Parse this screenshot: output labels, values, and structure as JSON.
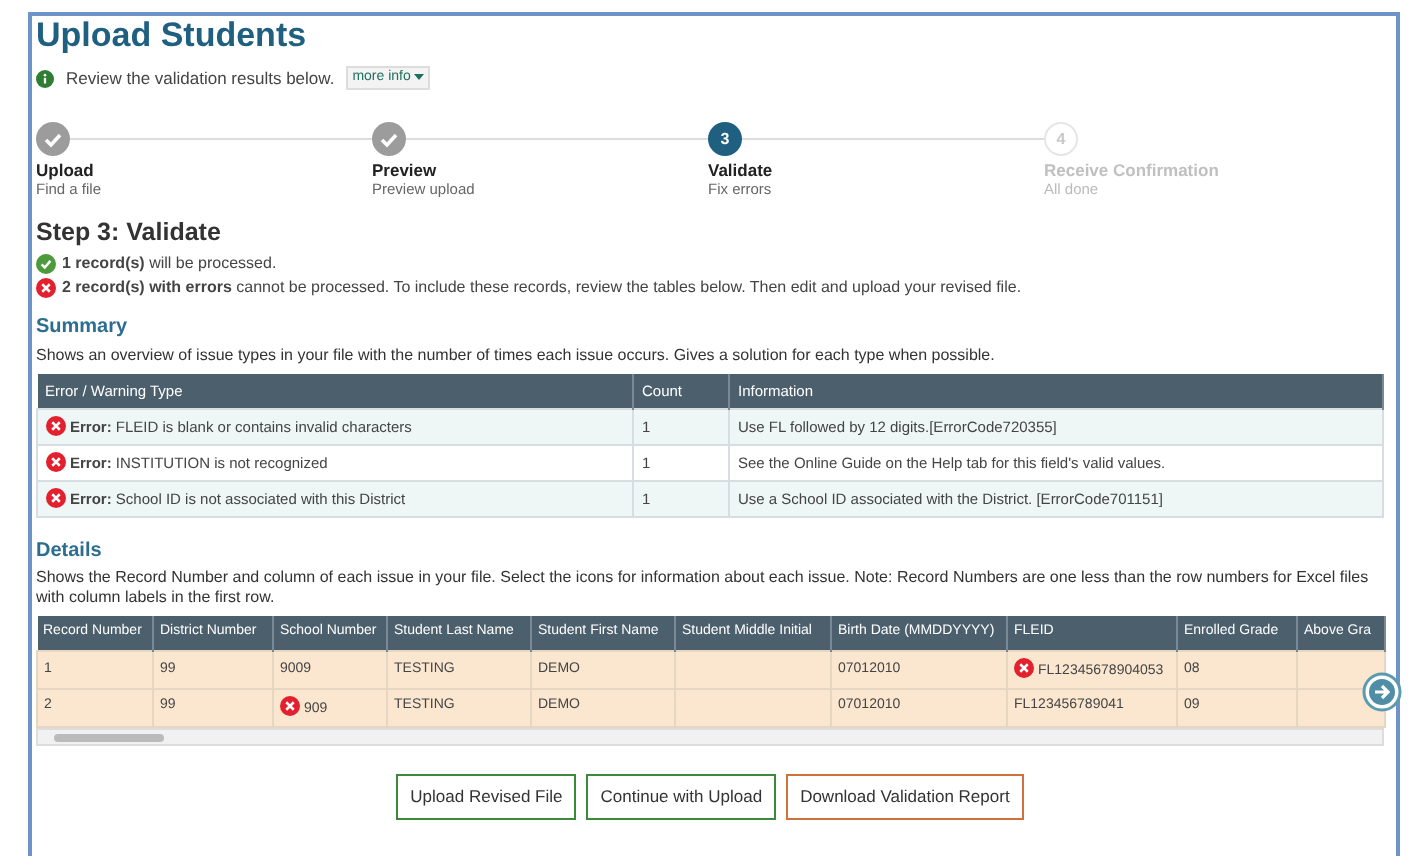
{
  "title": "Upload Students",
  "info": {
    "text": "Review the validation results below.",
    "more_info": "more info"
  },
  "steps": [
    {
      "label": "Upload",
      "sublabel": "Find a file",
      "kind": "done"
    },
    {
      "label": "Preview",
      "sublabel": "Preview upload",
      "kind": "done"
    },
    {
      "number": "3",
      "label": "Validate",
      "sublabel": "Fix errors",
      "kind": "current"
    },
    {
      "number": "4",
      "label": "Receive Confirmation",
      "sublabel": "All done",
      "kind": "pending"
    }
  ],
  "step_heading": "Step 3: Validate",
  "results": [
    {
      "kind": "ok",
      "text": "**1 record(s)** will be processed."
    },
    {
      "kind": "error",
      "text": "**2 record(s) with errors** cannot be processed. To include these records, review the tables below. Then edit and upload your revised file."
    }
  ],
  "summary": {
    "heading": "Summary",
    "description": "Shows an overview of issue types in your file with the number of times each issue occurs. Gives a solution for each type when possible.",
    "columns": [
      "Error / Warning Type",
      "Count",
      "Information"
    ],
    "rows": [
      {
        "kind": "error",
        "type": "**Error:** FLEID is blank or contains invalid characters",
        "count": "1",
        "information": "Use FL followed by 12 digits.[ErrorCode720355]"
      },
      {
        "kind": "error",
        "type": "**Error:** INSTITUTION is not recognized",
        "count": "1",
        "information": "See the Online Guide on the Help tab for this field's valid values."
      },
      {
        "kind": "error",
        "type": "**Error:** School ID is not associated with this District",
        "count": "1",
        "information": "Use a School ID associated with the District. [ErrorCode701151]"
      }
    ]
  },
  "details": {
    "heading": "Details",
    "description": "Shows the Record Number and column of each issue in your file. Select the icons for information about each issue. Note: Record Numbers are one less than the row numbers for Excel files with column labels in the first row.",
    "columns": [
      "Record Number",
      "District Number",
      "School Number",
      "Student Last Name",
      "Student First Name",
      "Student Middle Initial",
      "Birth Date (MMDDYYYY)",
      "FLEID",
      "Enrolled Grade",
      "Above Gra"
    ],
    "rows": [
      {
        "cells": [
          {
            "text": "1",
            "error": false
          },
          {
            "text": "99",
            "error": false
          },
          {
            "text": "9009",
            "error": false
          },
          {
            "text": "TESTING",
            "error": false
          },
          {
            "text": "DEMO",
            "error": false
          },
          {
            "text": "",
            "error": false
          },
          {
            "text": "07012010",
            "error": false
          },
          {
            "text": "FL12345678904053",
            "error": true
          },
          {
            "text": "08",
            "error": false
          },
          {
            "text": "",
            "error": false
          }
        ]
      },
      {
        "cells": [
          {
            "text": "2",
            "error": false
          },
          {
            "text": "99",
            "error": false
          },
          {
            "text": "909",
            "error": true
          },
          {
            "text": "TESTING",
            "error": false
          },
          {
            "text": "DEMO",
            "error": false
          },
          {
            "text": "",
            "error": false
          },
          {
            "text": "07012010",
            "error": false
          },
          {
            "text": "FL123456789041",
            "error": false
          },
          {
            "text": "09",
            "error": false
          },
          {
            "text": "",
            "error": false
          }
        ]
      }
    ]
  },
  "buttons": [
    {
      "label": "Upload Revised File",
      "color": "#3a8a3a"
    },
    {
      "label": "Continue with Upload",
      "color": "#3a8a3a"
    },
    {
      "label": "Download Validation Report",
      "color": "#d0703a"
    }
  ]
}
